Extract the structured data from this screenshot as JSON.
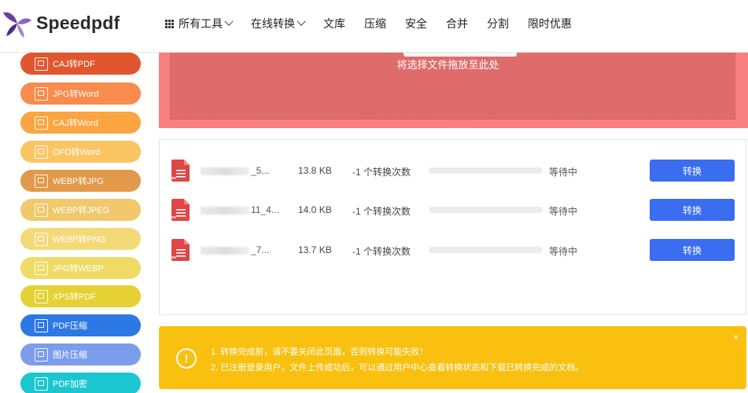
{
  "brand": {
    "name": "Speedpdf"
  },
  "nav": {
    "items": [
      {
        "label": "所有工具",
        "dropdown": true,
        "icon": "grid-icon"
      },
      {
        "label": "在线转换",
        "dropdown": true
      },
      {
        "label": "文库"
      },
      {
        "label": "压缩"
      },
      {
        "label": "安全"
      },
      {
        "label": "合并"
      },
      {
        "label": "分割"
      },
      {
        "label": "限时优惠"
      }
    ]
  },
  "sidebar": {
    "items": [
      {
        "label": "CAJ转PDF",
        "color": "#e0572f"
      },
      {
        "label": "JPG转Word",
        "color": "#f98b4c"
      },
      {
        "label": "CAJ转Word",
        "color": "#fba541"
      },
      {
        "label": "OFD转Word",
        "color": "#fcc564"
      },
      {
        "label": "WEBP转JPG",
        "color": "#e3994a"
      },
      {
        "label": "WEBP转JPEG",
        "color": "#f1c86b"
      },
      {
        "label": "WEBP转PNG",
        "color": "#f4d979"
      },
      {
        "label": "JPG转WEBP",
        "color": "#f0db66"
      },
      {
        "label": "XPS转PDF",
        "color": "#e5d133"
      },
      {
        "label": "PDF压缩",
        "color": "#2c78e4"
      },
      {
        "label": "图片压缩",
        "color": "#7c9cec"
      },
      {
        "label": "PDF加密",
        "color": "#1cc6d0"
      }
    ]
  },
  "dropzone": {
    "text": "将选择文件拖放至此处"
  },
  "files": [
    {
      "name_suffix": "_5...",
      "size": "13.8 KB",
      "count": "-1 个转换次数",
      "progress": 0,
      "status": "等待中",
      "action": "转换"
    },
    {
      "name_suffix": "11_4...",
      "size": "14.0 KB",
      "count": "-1 个转换次数",
      "progress": 0,
      "status": "等待中",
      "action": "转换"
    },
    {
      "name_suffix": "_7...",
      "size": "13.7 KB",
      "count": "-1 个转换次数",
      "progress": 0,
      "status": "等待中",
      "action": "转换"
    }
  ],
  "notice": {
    "icon": "!",
    "close": "×",
    "lines": [
      "1. 转换完成前，请不要关闭此页面，否则转换可能失败！",
      "2. 已注册登录用户，文件上传成功后，可以通过用户中心查看转换状态和下载已转换完成的文档。"
    ]
  },
  "colors": {
    "accent": "#3a6df0",
    "dropzone": "#f87f7f",
    "notice": "#fac010"
  }
}
